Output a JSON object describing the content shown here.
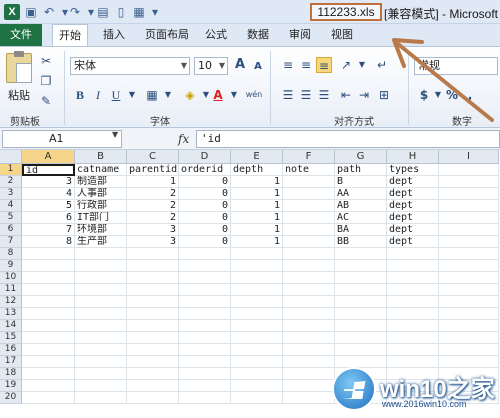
{
  "window": {
    "app_icon": "excel-icon",
    "filename": "112233.xls",
    "title_rest": "[兼容模式] - Microsoft Ex"
  },
  "tabs": {
    "file": "文件",
    "items": [
      "开始",
      "插入",
      "页面布局",
      "公式",
      "数据",
      "审阅",
      "视图"
    ],
    "active": "开始"
  },
  "ribbon": {
    "paste_label": "粘贴",
    "clipboard_group": "剪贴板",
    "font_group": "字体",
    "align_group": "对齐方式",
    "number_group": "数字",
    "font_name": "宋体",
    "font_size": "10",
    "number_format": "常规",
    "bold": "B",
    "italic": "I",
    "underline": "U",
    "grow_font": "A",
    "shrink_font": "A",
    "font_color": "A",
    "wen": "wén",
    "currency": "$",
    "percent": "%",
    "comma": ","
  },
  "formula_bar": {
    "name_box": "A1",
    "fx": "fx",
    "content": "'id"
  },
  "sheet": {
    "columns": [
      "A",
      "B",
      "C",
      "D",
      "E",
      "F",
      "G",
      "H",
      "I"
    ],
    "rows": [
      "1",
      "2",
      "3",
      "4",
      "5",
      "6",
      "7",
      "8",
      "9",
      "10",
      "11",
      "12",
      "13",
      "14",
      "15",
      "16",
      "17",
      "18",
      "19",
      "20"
    ],
    "cells": [
      [
        "id",
        "catname",
        "parentid",
        "orderid",
        "depth",
        "note",
        "path",
        "types"
      ],
      [
        "3",
        "制造部",
        "1",
        "0",
        "1",
        "",
        "B",
        "dept"
      ],
      [
        "4",
        "人事部",
        "2",
        "0",
        "1",
        "",
        "AA",
        "dept"
      ],
      [
        "5",
        "行政部",
        "2",
        "0",
        "1",
        "",
        "AB",
        "dept"
      ],
      [
        "6",
        "IT部门",
        "2",
        "0",
        "1",
        "",
        "AC",
        "dept"
      ],
      [
        "7",
        "环境部",
        "3",
        "0",
        "1",
        "",
        "BA",
        "dept"
      ],
      [
        "8",
        "生产部",
        "3",
        "0",
        "1",
        "",
        "BB",
        "dept"
      ]
    ]
  },
  "annotation": {
    "highlight_color": "#c0703a",
    "arrow_color": "#b87a4b"
  },
  "watermark": {
    "title": "win10之家",
    "url": "www.2016win10.com"
  }
}
